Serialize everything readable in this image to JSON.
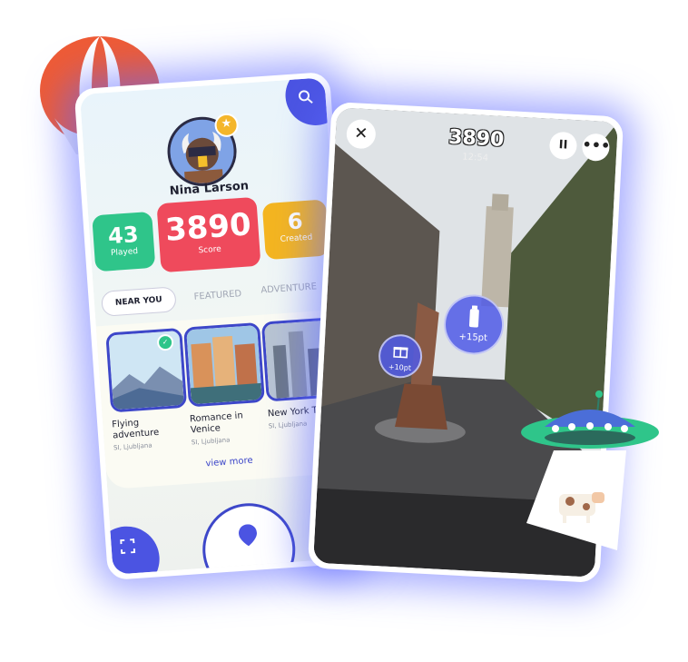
{
  "profile": {
    "name": "Nina Larson"
  },
  "stats": {
    "played_value": "43",
    "played_label": "Played",
    "score_value": "3890",
    "score_label": "Score",
    "created_value": "6",
    "created_label": "Created"
  },
  "tabs": {
    "near_you": "NEAR YOU",
    "featured": "FEATURED",
    "adventure": "ADVENTURE"
  },
  "cards": [
    {
      "title": "Flying adventure",
      "location": "SI, Ljubljana"
    },
    {
      "title": "Romance in Venice",
      "location": "SI, Ljubljana"
    },
    {
      "title": "New York Tour",
      "location": "SI, Ljubljana"
    }
  ],
  "view_more": "view more",
  "game": {
    "score": "3890",
    "timer": "12:54",
    "bubble_big": "+15pt",
    "bubble_small": "+10pt"
  },
  "colors": {
    "accent": "#4b54e2",
    "played": "#2fc58a",
    "score": "#ef4a5c",
    "created": "#f4b520",
    "glow": "#5c68ff"
  },
  "icons": [
    "search-icon",
    "star-icon",
    "check-icon",
    "scan-icon",
    "map-pin-icon",
    "close-icon",
    "pause-icon",
    "more-icon",
    "gift-icon",
    "can-icon"
  ]
}
